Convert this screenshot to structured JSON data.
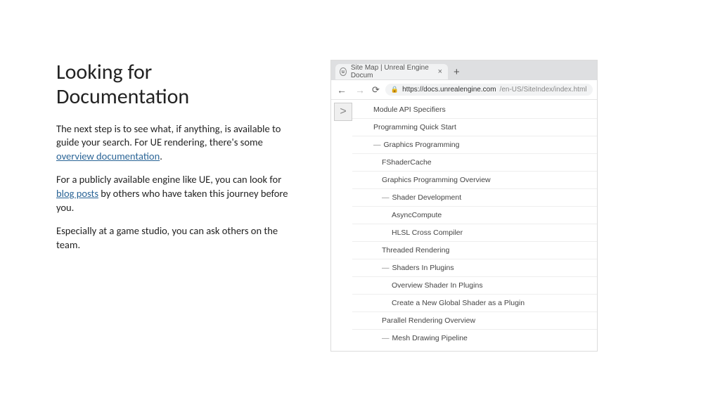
{
  "slide": {
    "title": "Looking for Documentation",
    "p1_a": "The next step is to see what, if anything, is available to guide your search. For UE rendering, there's some ",
    "p1_link": "overview documentation",
    "p1_b": ".",
    "p2_a": "For a publicly available engine like UE, you can look for ",
    "p2_link": "blog posts",
    "p2_b": " by others who have taken this journey before you.",
    "p3": "Especially at a game studio, you can ask others on the team."
  },
  "browser": {
    "tab_title": "Site Map | Unreal Engine Docum",
    "url_domain": "https://docs.unrealengine.com",
    "url_path": "/en-US/SiteIndex/index.html",
    "expand": ">",
    "plus": "+",
    "close": "×",
    "back": "←",
    "fwd": "→",
    "reload": "⟳",
    "lock": "🔒"
  },
  "tree": [
    {
      "level": 0,
      "expandable": false,
      "label": "Module API Specifiers"
    },
    {
      "level": 0,
      "expandable": false,
      "label": "Programming Quick Start"
    },
    {
      "level": 0,
      "expandable": true,
      "label": "Graphics Programming"
    },
    {
      "level": 1,
      "expandable": false,
      "label": "FShaderCache"
    },
    {
      "level": 1,
      "expandable": false,
      "label": "Graphics Programming Overview"
    },
    {
      "level": 1,
      "expandable": true,
      "label": "Shader Development"
    },
    {
      "level": 2,
      "expandable": false,
      "label": "AsyncCompute"
    },
    {
      "level": 2,
      "expandable": false,
      "label": "HLSL Cross Compiler"
    },
    {
      "level": 1,
      "expandable": false,
      "label": "Threaded Rendering"
    },
    {
      "level": 1,
      "expandable": true,
      "label": "Shaders In Plugins"
    },
    {
      "level": 2,
      "expandable": false,
      "label": "Overview Shader In Plugins"
    },
    {
      "level": 2,
      "expandable": false,
      "label": "Create a New Global Shader as a Plugin"
    },
    {
      "level": 1,
      "expandable": false,
      "label": "Parallel Rendering Overview"
    },
    {
      "level": 1,
      "expandable": true,
      "label": "Mesh Drawing Pipeline"
    }
  ]
}
